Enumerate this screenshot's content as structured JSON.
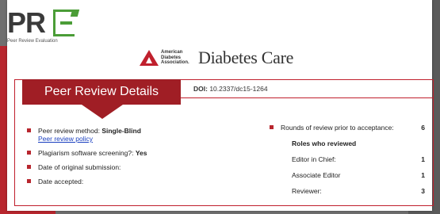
{
  "logo": {
    "letters_pr": "PR",
    "subtitle": "Peer Review Evaluation"
  },
  "journal": {
    "ada_line1": "American",
    "ada_line2": "Diabetes",
    "ada_line3": "Association.",
    "name": "Diabetes Care"
  },
  "header": {
    "title": "Peer Review Details"
  },
  "doi": {
    "label": "DOI:",
    "value": "10.2337/dc15-1264"
  },
  "left": {
    "method_label": "Peer review method:",
    "method_value": "Single-Blind",
    "policy_link": "Peer review policy",
    "plagiarism_label": "Plagiarism software screening?:",
    "plagiarism_value": "Yes",
    "submission_label": "Date of original submission:",
    "accepted_label": "Date accepted:"
  },
  "right": {
    "rounds_label": "Rounds of review prior to acceptance:",
    "rounds_value": "6",
    "roles_heading": "Roles who reviewed",
    "roles": [
      {
        "label": "Editor in Chief:",
        "value": "1"
      },
      {
        "label": "Associate Editor",
        "value": "1"
      },
      {
        "label": "Reviewer:",
        "value": "3"
      }
    ]
  },
  "colors": {
    "accent": "#c0202d",
    "header_bg": "#a01e25",
    "logo_green": "#4b9d37"
  }
}
